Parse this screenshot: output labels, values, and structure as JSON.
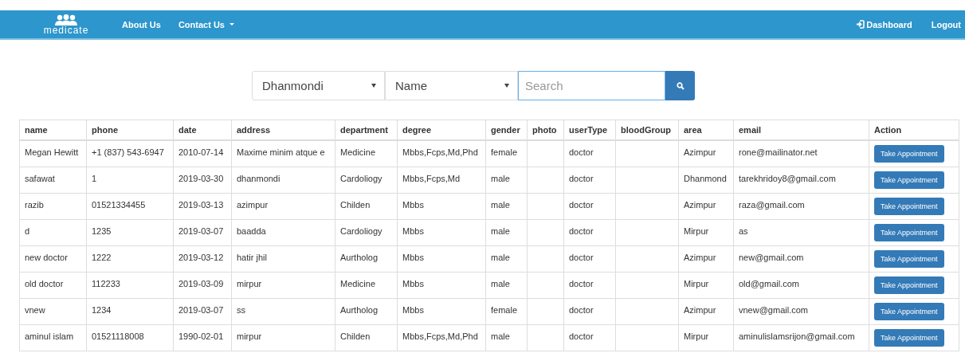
{
  "navbar": {
    "brand": "medicate",
    "links": [
      {
        "label": "About Us",
        "kind": "link"
      },
      {
        "label": "Contact Us",
        "kind": "dropdown"
      }
    ],
    "right_links": [
      {
        "label": "Dashboard",
        "kind": "icon"
      },
      {
        "label": "Logout",
        "kind": "plain"
      }
    ]
  },
  "filters": {
    "area_select": "Dhanmondi",
    "field_select": "Name",
    "search": {
      "placeholder": "Search"
    }
  },
  "table": {
    "columns": [
      {
        "label": "name",
        "kind": "data"
      },
      {
        "label": "phone",
        "kind": "data"
      },
      {
        "label": "date",
        "kind": "data"
      },
      {
        "label": "address",
        "kind": "data"
      },
      {
        "label": "department",
        "kind": "data"
      },
      {
        "label": "degree",
        "kind": "data"
      },
      {
        "label": "gender",
        "kind": "data"
      },
      {
        "label": "photo",
        "kind": "empty"
      },
      {
        "label": "userType",
        "kind": "data"
      },
      {
        "label": "bloodGroup",
        "kind": "empty"
      },
      {
        "label": "area",
        "kind": "data"
      },
      {
        "label": "email",
        "kind": "data"
      },
      {
        "label": "Action",
        "kind": "action"
      }
    ],
    "rows": [
      {
        "cells": [
          "Megan Hewitt",
          "+1 (837) 543-6947",
          "2010-07-14",
          "Maxime minim atque e",
          "Medicine",
          "Mbbs,Fcps,Md,Phd",
          "female",
          "",
          "doctor",
          "",
          "Azimpur",
          "rone@mailinator.net",
          "Take Appointment"
        ]
      },
      {
        "cells": [
          "safawat",
          "1",
          "2019-03-30",
          "dhanmondi",
          "Cardoliogy",
          "Mbbs,Fcps,Md",
          "male",
          "",
          "doctor",
          "",
          "Dhanmond",
          "tarekhridoy8@gmail.com",
          "Take Appointment"
        ]
      },
      {
        "cells": [
          "razib",
          "01521334455",
          "2019-03-13",
          "azimpur",
          "Childen",
          "Mbbs",
          "male",
          "",
          "doctor",
          "",
          "Azimpur",
          "raza@gmail.com",
          "Take Appointment"
        ]
      },
      {
        "cells": [
          "d",
          "1235",
          "2019-03-07",
          "baadda",
          "Cardoliogy",
          "Mbbs",
          "male",
          "",
          "doctor",
          "",
          "Mirpur",
          "as",
          "Take Appointment"
        ]
      },
      {
        "cells": [
          "new doctor",
          "1222",
          "2019-03-12",
          "hatir jhil",
          "Aurtholog",
          "Mbbs",
          "male",
          "",
          "doctor",
          "",
          "Azimpur",
          "new@gmail.com",
          "Take Appointment"
        ]
      },
      {
        "cells": [
          "old doctor",
          "112233",
          "2019-03-09",
          "mirpur",
          "Medicine",
          "Mbbs",
          "male",
          "",
          "doctor",
          "",
          "Mirpur",
          "old@gmail.com",
          "Take Appointment"
        ]
      },
      {
        "cells": [
          "vnew",
          "1234",
          "2019-03-07",
          "ss",
          "Aurtholog",
          "Mbbs",
          "female",
          "",
          "doctor",
          "",
          "Azimpur",
          "vnew@gmail.com",
          "Take Appointment"
        ]
      },
      {
        "cells": [
          "aminul islam",
          "01521118008",
          "1990-02-01",
          "mirpur",
          "Childen",
          "Mbbs,Fcps,Md,Phd",
          "male",
          "",
          "doctor",
          "",
          "Mirpur",
          "aminulislamsrijon@gmail.com",
          "Take Appointment"
        ]
      }
    ]
  }
}
